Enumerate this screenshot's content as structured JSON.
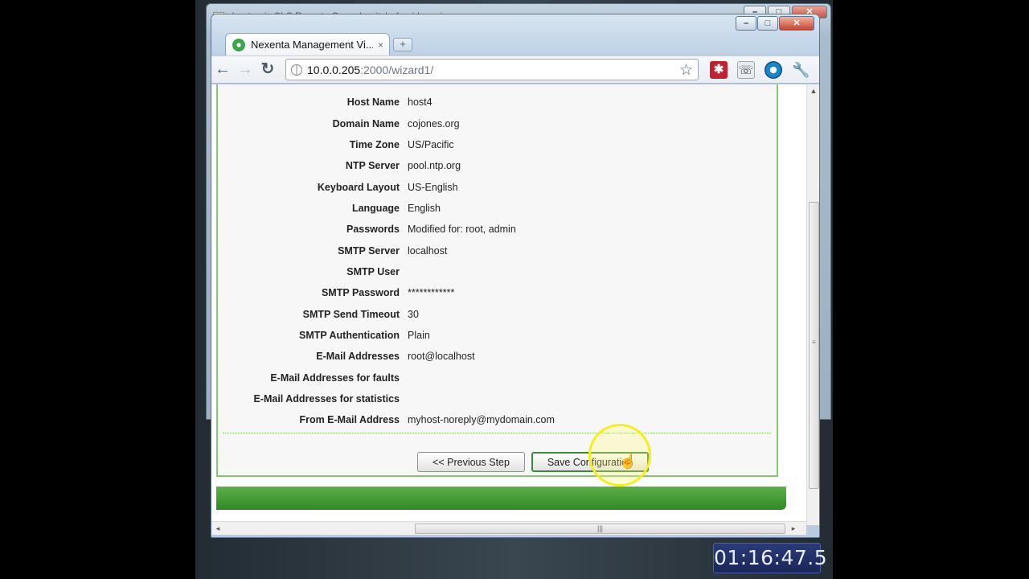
{
  "background_window": {
    "title": "Lantronix SLS Remote Console - itchef-spider.cojones.org",
    "controls": [
      "–",
      "□",
      "✕"
    ]
  },
  "browser": {
    "window_controls": [
      "–",
      "□",
      "✕"
    ],
    "tab": {
      "title": "Nexenta Management Vi...",
      "close": "×",
      "favicon": "nexenta-logo-icon"
    },
    "new_tab_label": "+",
    "nav": {
      "back": "←",
      "forward": "→",
      "reload": "↻"
    },
    "address": {
      "host": "10.0.0.205",
      "rest": ":2000/wizard1/"
    },
    "toolbar_icons": [
      "star-icon",
      "extension-icon",
      "phone-icon",
      "eye-icon",
      "wrench-icon"
    ]
  },
  "summary": {
    "rows": [
      {
        "label": "Host Name",
        "value": "host4"
      },
      {
        "label": "Domain Name",
        "value": "cojones.org"
      },
      {
        "label": "Time Zone",
        "value": "US/Pacific"
      },
      {
        "label": "NTP Server",
        "value": "pool.ntp.org"
      },
      {
        "label": "Keyboard Layout",
        "value": "US-English"
      },
      {
        "label": "Language",
        "value": "English"
      },
      {
        "label": "Passwords",
        "value": "Modified for: root, admin"
      },
      {
        "label": "SMTP Server",
        "value": "localhost"
      },
      {
        "label": "SMTP User",
        "value": ""
      },
      {
        "label": "SMTP Password",
        "value": "************"
      },
      {
        "label": "SMTP Send Timeout",
        "value": "30"
      },
      {
        "label": "SMTP Authentication",
        "value": "Plain"
      },
      {
        "label": "E-Mail Addresses",
        "value": "root@localhost"
      },
      {
        "label": "E-Mail Addresses for faults",
        "value": ""
      },
      {
        "label": "E-Mail Addresses for statistics",
        "value": ""
      },
      {
        "label": "From E-Mail Address",
        "value": "myhost-noreply@mydomain.com"
      }
    ]
  },
  "actions": {
    "previous_label": "<< Previous Step",
    "save_label": "Save Configuration"
  },
  "timecode": "01:16:47.5",
  "colors": {
    "accent_green": "#3f9a30",
    "panel_border": "#86c76f",
    "highlight_yellow": "#f5ee1d"
  }
}
